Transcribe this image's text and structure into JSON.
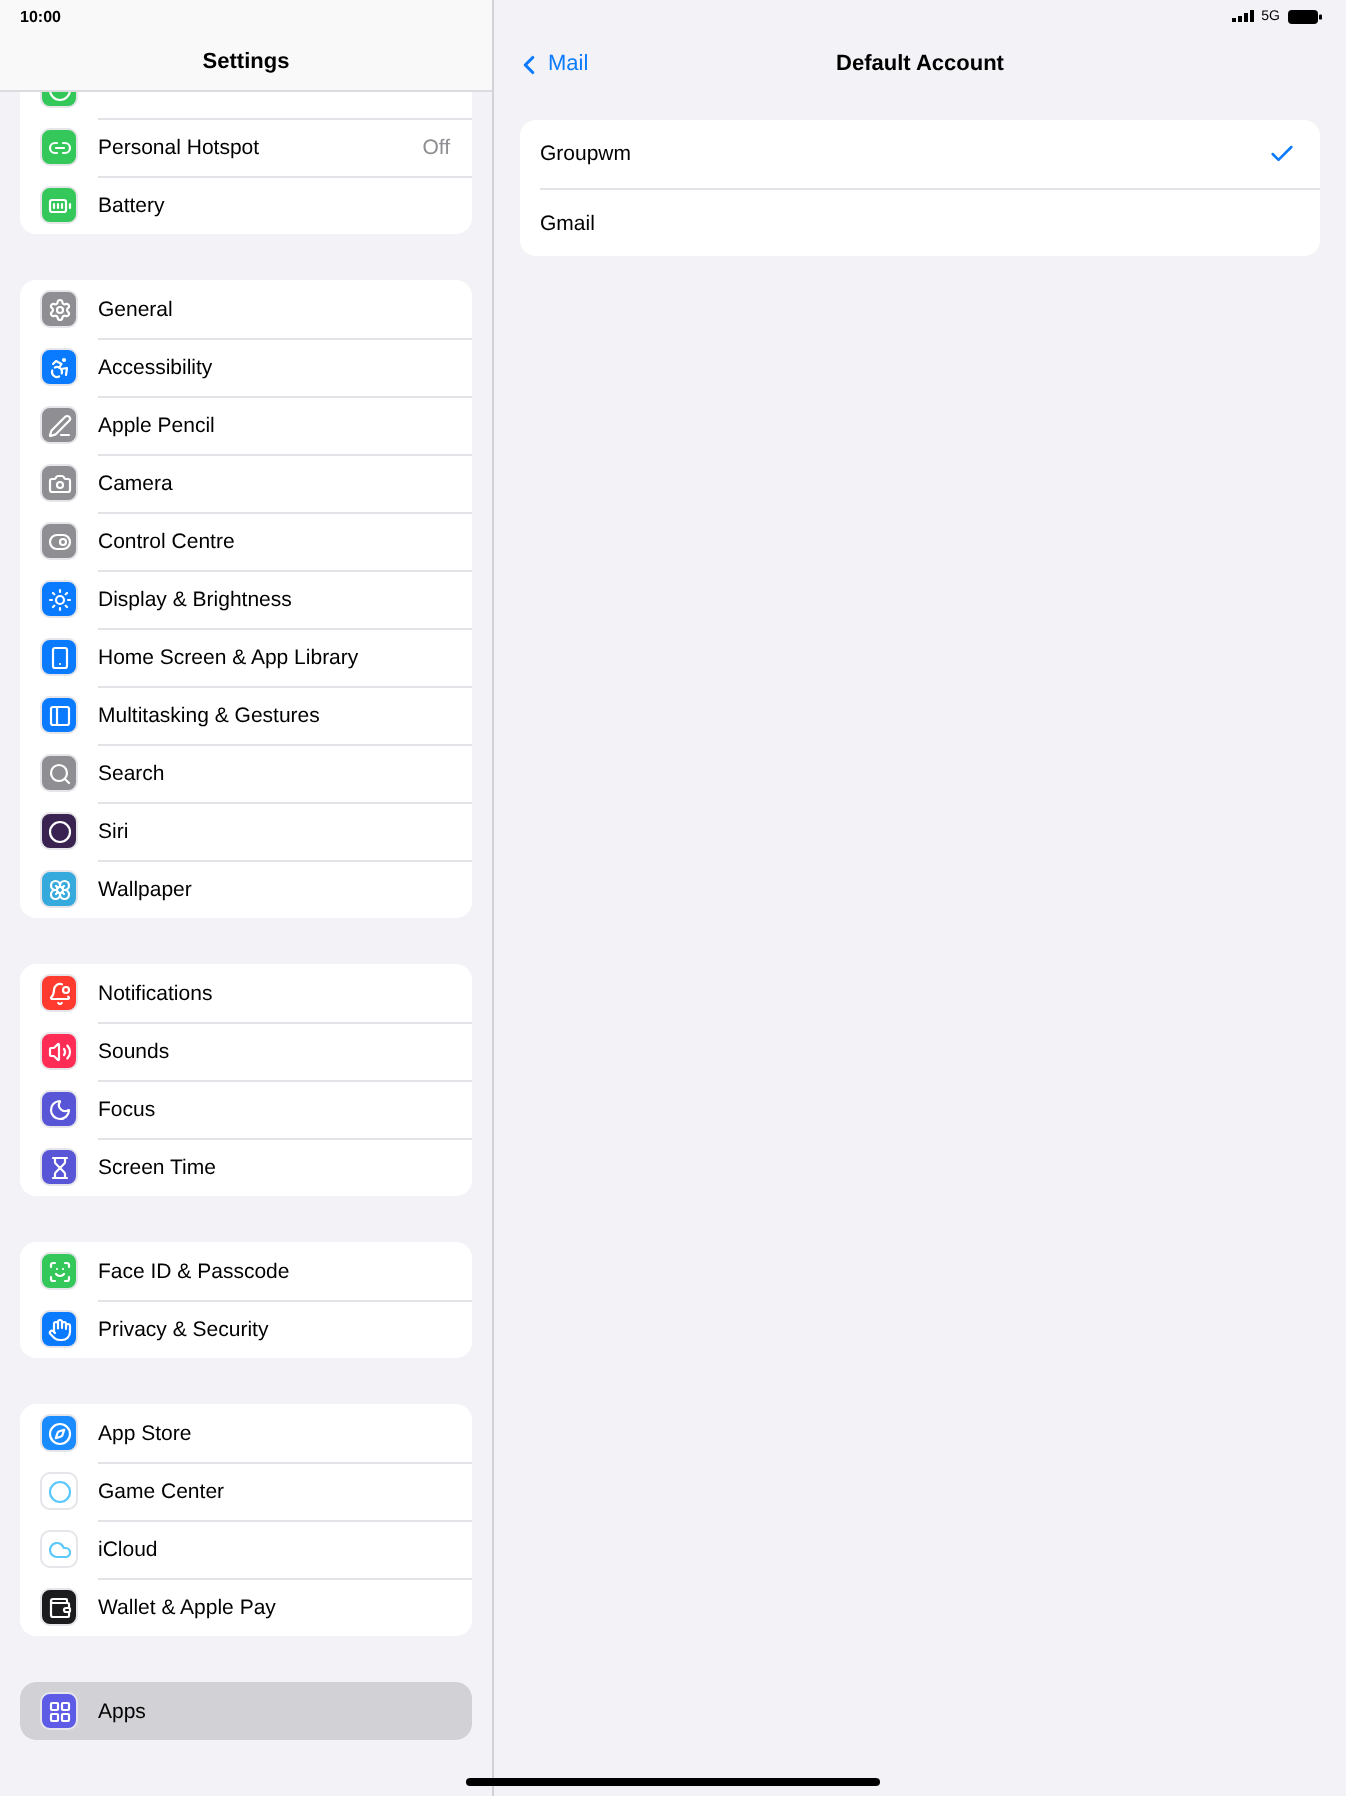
{
  "status_bar": {
    "time": "10:00",
    "network": "5G"
  },
  "sidebar": {
    "title": "Settings",
    "groups": [
      {
        "items": [
          {
            "selected": false,
            "color": "#34c759"
          },
          {
            "label": "Personal Hotspot",
            "value": "Off",
            "selected": false,
            "color": "#34c759"
          },
          {
            "label": "Battery",
            "selected": false,
            "color": "#34c759"
          }
        ]
      },
      {
        "items": [
          {
            "label": "General",
            "selected": false,
            "color": "#8e8e93"
          },
          {
            "label": "Accessibility",
            "selected": false,
            "color": "#0a7aff"
          },
          {
            "label": "Apple Pencil",
            "selected": false,
            "color": "#8e8e93"
          },
          {
            "label": "Camera",
            "selected": false,
            "color": "#8e8e93"
          },
          {
            "label": "Control Centre",
            "selected": false,
            "color": "#8e8e93"
          },
          {
            "label": "Display & Brightness",
            "selected": false,
            "color": "#0a7aff"
          },
          {
            "label": "Home Screen & App Library",
            "selected": false,
            "color": "#0a7aff"
          },
          {
            "label": "Multitasking & Gestures",
            "selected": false,
            "color": "#0a7aff"
          },
          {
            "label": "Search",
            "selected": false,
            "color": "#8e8e93"
          },
          {
            "label": "Siri",
            "selected": false,
            "color": "#3a2350"
          },
          {
            "label": "Wallpaper",
            "selected": false,
            "color": "#36aadc"
          }
        ]
      },
      {
        "items": [
          {
            "label": "Notifications",
            "selected": false,
            "color": "#ff3b30"
          },
          {
            "label": "Sounds",
            "selected": false,
            "color": "#ff2d55"
          },
          {
            "label": "Focus",
            "selected": false,
            "color": "#5856d6"
          },
          {
            "label": "Screen Time",
            "selected": false,
            "color": "#5856d6"
          }
        ]
      },
      {
        "items": [
          {
            "label": "Face ID & Passcode",
            "selected": false,
            "color": "#34c759"
          },
          {
            "label": "Privacy & Security",
            "selected": false,
            "color": "#0a7aff"
          }
        ]
      },
      {
        "items": [
          {
            "label": "App Store",
            "selected": false,
            "color": "#1a8cff"
          },
          {
            "label": "Game Center",
            "selected": false,
            "color": "#ffffff"
          },
          {
            "label": "iCloud",
            "selected": false,
            "color": "#ffffff"
          },
          {
            "label": "Wallet & Apple Pay",
            "selected": false,
            "color": "#1c1c1e"
          }
        ]
      },
      {
        "items": [
          {
            "label": "Apps",
            "selected": true,
            "color": "#5e5ce6"
          }
        ]
      }
    ]
  },
  "detail": {
    "back": "Mail",
    "title": "Default Account",
    "options": [
      {
        "label": "Groupwm",
        "selected": true
      },
      {
        "label": "Gmail",
        "selected": false
      }
    ]
  }
}
